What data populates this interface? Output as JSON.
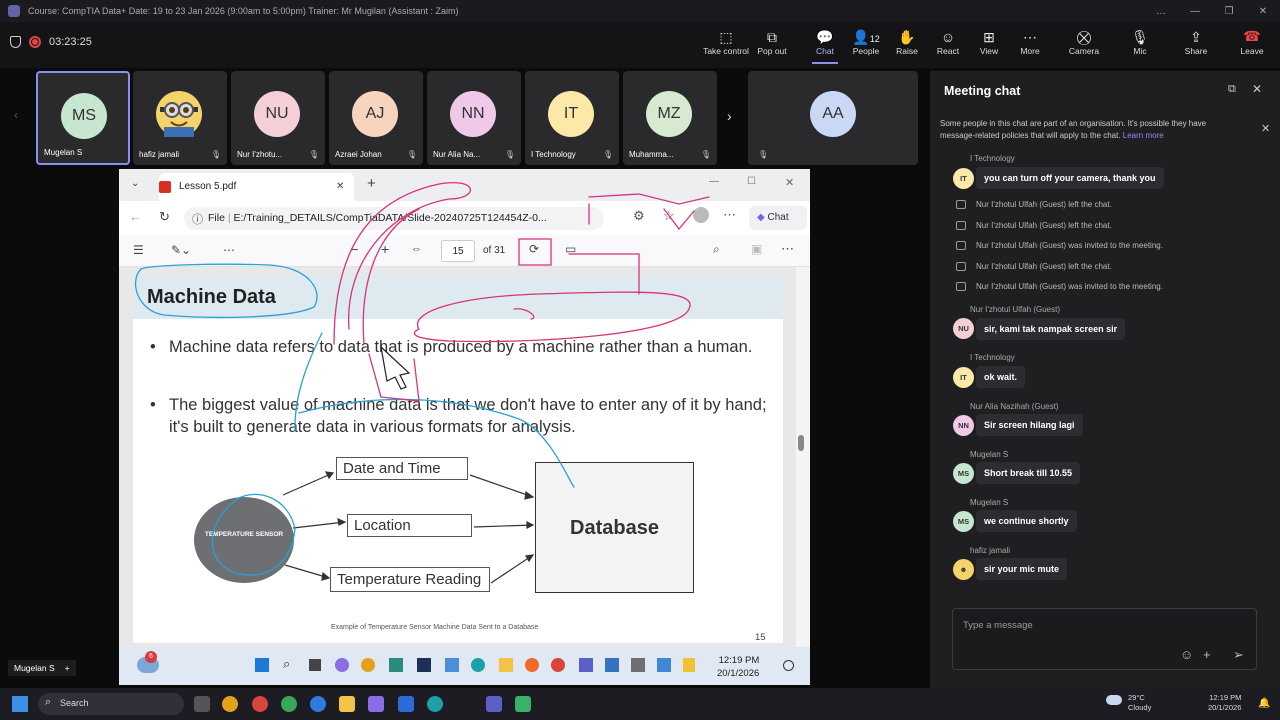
{
  "window": {
    "title": "Course: CompTIA Data+ Date: 19 to 23 Jan 2026 (9:00am to 5:00pm) Trainer: Mr Mugilan (Assistant : Zaim)",
    "controls": [
      "…",
      "—",
      "❐",
      "✕"
    ]
  },
  "meeting": {
    "timer": "03:23:25"
  },
  "toolbar": {
    "take_control": "Take control",
    "pop_out": "Pop out",
    "chat": "Chat",
    "people": "People",
    "people_count": "12",
    "raise": "Raise",
    "react": "React",
    "view": "View",
    "more": "More",
    "camera": "Camera",
    "mic": "Mic",
    "share": "Share",
    "leave": "Leave"
  },
  "participants": [
    {
      "initials": "MS",
      "name": "Mugelan S",
      "color": "#c7e6cf"
    },
    {
      "initials": "",
      "name": "hafiz jamali",
      "color": "#f3d36b"
    },
    {
      "initials": "NU",
      "name": "Nur I'zhotu...",
      "color": "#f5cfd8"
    },
    {
      "initials": "AJ",
      "name": "Azraei Johan",
      "color": "#f7d4bd"
    },
    {
      "initials": "NN",
      "name": "Nur Alia Na...",
      "color": "#f0c9e8"
    },
    {
      "initials": "IT",
      "name": "I Technology",
      "color": "#fce9a8"
    },
    {
      "initials": "MZ",
      "name": "Muhamma...",
      "color": "#d6ead0"
    },
    {
      "initials": "AA",
      "name": "",
      "color": "#c9d8f5"
    }
  ],
  "chat": {
    "title": "Meeting chat",
    "notice": "Some people in this chat are part of an organisation. It's possible they have message-related policies that will apply to the chat.",
    "learn_more": "Learn more",
    "messages": [
      {
        "sender": "I Technology",
        "text": "you can turn off your camera, thank you",
        "initials": "IT"
      },
      {
        "sender": "Nur I'zhotul Ulfah (Guest)",
        "text": "sir, kami tak nampak screen sir",
        "initials": "NU"
      },
      {
        "sender": "I Technology",
        "text": "ok wait.",
        "initials": "IT"
      },
      {
        "sender": "Nur Alia Nazihah (Guest)",
        "text": "Sir screen hilang lagi",
        "initials": "NN"
      },
      {
        "sender": "Mugelan S",
        "text": "Short break till 10.55",
        "initials": "MS"
      },
      {
        "sender": "Mugelan S",
        "text": "we continue shortly",
        "initials": "MS"
      },
      {
        "sender": "hafiz jamali",
        "text": "sir your mic mute",
        "initials": ""
      }
    ],
    "system": [
      "Nur I'zhotul Ulfah (Guest) left the chat.",
      "Nur I'zhotul Ulfah (Guest) left the chat.",
      "Nur I'zhotul Ulfah (Guest) was invited to the meeting.",
      "Nur I'zhotul Ulfah (Guest) left the chat.",
      "Nur I'zhotul Ulfah (Guest) was invited to the meeting."
    ],
    "compose_placeholder": "Type a message"
  },
  "shared": {
    "tab_title": "Lesson 5.pdf",
    "file_label": "File",
    "address": "E:/Training_DETAILS/CompTiaDATA/Slide-20240725T124454Z-0...",
    "copilot": "Chat",
    "page_current": "15",
    "page_total": "of 31",
    "slide": {
      "title": "Machine Data",
      "bullet1": "Machine data refers to data that is produced by a machine rather than a human.",
      "bullet2": "The biggest value of machine data is that we don't have to enter any of it by hand; it's built to generate data in various formats for analysis.",
      "sensor": "TEMPERATURE SENSOR",
      "box_date": "Date and Time",
      "box_location": "Location",
      "box_temp": "Temperature Reading",
      "database": "Database",
      "caption": "Example of Temperature Sensor Machine Data Sent to a Database",
      "page_number": "15"
    },
    "inner_clock_time": "12:19 PM",
    "inner_clock_date": "20/1/2026",
    "notif_badge": "6"
  },
  "presenter": {
    "name": "Mugelan S",
    "add": "+"
  },
  "taskbar": {
    "search": "Search",
    "weather_temp": "29°C",
    "weather_desc": "Cloudy",
    "time": "12:19 PM",
    "date": "20/1/2026"
  }
}
